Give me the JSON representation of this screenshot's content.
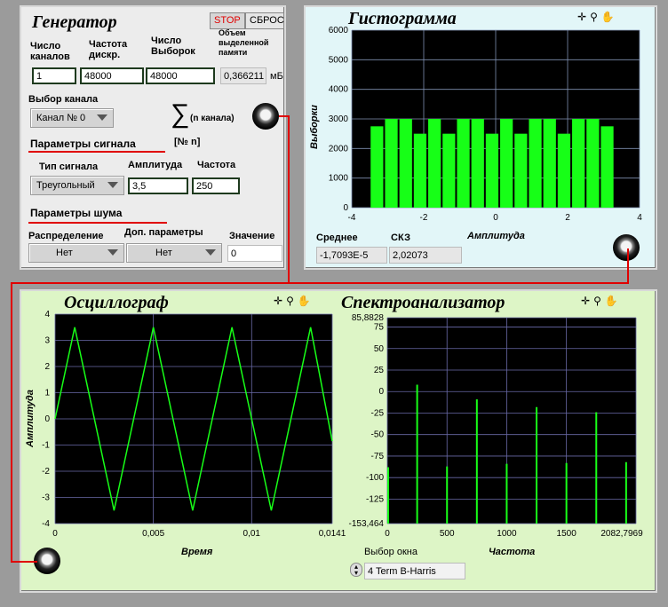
{
  "generator": {
    "title": "Генератор",
    "stop_label": "STOP",
    "reset_label": "СБРОС",
    "channels_label": "Число\nканалов",
    "sample_rate_label": "Частота\nдискр.",
    "samples_label": "Число\nВыборок",
    "memory_label": "Объем\nвыделенной\nпамяти",
    "channels_value": "1",
    "sample_rate_value": "48000",
    "samples_value": "48000",
    "memory_value": "0,366211",
    "memory_unit": "мБ",
    "channel_select_label": "Выбор канала",
    "channel_select_value": "Канал № 0",
    "sum_symbol": "∑",
    "sum_note": "(n канала)",
    "sum_index": "[№ n]",
    "signal_params_label": "Параметры сигнала",
    "signal_type_label": "Тип сигнала",
    "signal_type_value": "Треугольный",
    "amplitude_label": "Амплитуда",
    "amplitude_value": "3,5",
    "frequency_label": "Частота",
    "frequency_value": "250",
    "noise_params_label": "Параметры шума",
    "distribution_label": "Распределение",
    "distribution_value": "Нет",
    "extra_params_label": "Доп. параметры",
    "extra_params_value": "Нет",
    "value_label": "Значение",
    "value_value": "0"
  },
  "histogram": {
    "title": "Гистограмма",
    "mean_label": "Среднее",
    "mean_value": "-1,7093E-5",
    "rms_label": "СКЗ",
    "rms_value": "2,02073"
  },
  "oscilloscope": {
    "title": "Осциллограф"
  },
  "spectrum": {
    "title": "Спектроанализатор",
    "window_label": "Выбор окна",
    "window_value": "4 Term B-Harris"
  },
  "tools_icons": [
    "crosshair-icon",
    "zoom-icon",
    "hand-icon"
  ],
  "colors": {
    "trace": "#17ff17",
    "wire": "#e00000",
    "plot_bg": "#000000"
  },
  "chart_data": [
    {
      "type": "bar",
      "title": "Гистограмма",
      "xlabel": "Амплитуда",
      "ylabel": "Выборки",
      "xlim": [
        -4,
        4
      ],
      "ylim": [
        0,
        6000
      ],
      "xticks": [
        "-4",
        "-2",
        "0",
        "2",
        "4"
      ],
      "yticks": [
        "0",
        "1000",
        "2000",
        "3000",
        "4000",
        "5000",
        "6000"
      ],
      "bin_width": 0.4,
      "x": [
        -3.3,
        -2.9,
        -2.5,
        -2.1,
        -1.7,
        -1.3,
        -0.9,
        -0.5,
        -0.1,
        0.3,
        0.7,
        1.1,
        1.5,
        1.9,
        2.3,
        2.7,
        3.1
      ],
      "values": [
        2750,
        3000,
        3000,
        2500,
        3000,
        2500,
        3000,
        3000,
        2500,
        3000,
        2500,
        3000,
        3000,
        2500,
        3000,
        3000,
        2750
      ]
    },
    {
      "type": "line",
      "title": "Осциллограф",
      "xlabel": "Время",
      "ylabel": "Амплитуда",
      "xlim": [
        0,
        0.0141
      ],
      "ylim": [
        -4,
        4
      ],
      "xticks": [
        "0",
        "0,005",
        "0,01",
        "0,0141"
      ],
      "yticks": [
        "4",
        "3",
        "2",
        "1",
        "0",
        "-1",
        "-2",
        "-3",
        "-4"
      ],
      "series": [
        {
          "x": [
            0,
            0.001,
            0.003,
            0.005,
            0.007,
            0.009,
            0.011,
            0.013,
            0.0141
          ],
          "values": [
            0,
            3.5,
            -3.5,
            3.5,
            -3.5,
            3.5,
            -3.5,
            3.5,
            -0.85
          ]
        }
      ]
    },
    {
      "type": "bar",
      "title": "Спектроанализатор",
      "xlabel": "Частота",
      "xlim": [
        0,
        2082.79
      ],
      "ylim": [
        -153.464,
        85.8828
      ],
      "xticks": [
        "0",
        "500",
        "1000",
        "1500",
        "2082,7969"
      ],
      "yticks": [
        "85,8828",
        "75",
        "50",
        "25",
        "0",
        "-25",
        "-50",
        "-75",
        "-100",
        "-125",
        "-153,464"
      ],
      "x": [
        0,
        250,
        500,
        750,
        1000,
        1250,
        1500,
        1750,
        2000
      ],
      "values": [
        -88,
        8,
        -87,
        -9,
        -84,
        -18,
        -83,
        -24,
        -82
      ]
    }
  ]
}
